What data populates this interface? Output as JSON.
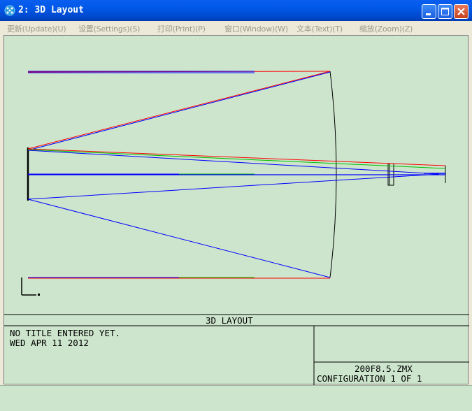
{
  "window": {
    "title": "2: 3D Layout",
    "minimize_label": "minimize",
    "maximize_label": "maximize",
    "close_label": "close"
  },
  "menu": [
    {
      "label": "更新(Update)(U)"
    },
    {
      "label": "设置(Settings)(S)"
    },
    {
      "label": "打印(Print)(P)"
    },
    {
      "label": "窗口(Window)(W)"
    },
    {
      "label": "文本(Text)(T)"
    },
    {
      "label": "缩放(Zoom)(Z)"
    }
  ],
  "plot": {
    "header": "3D LAYOUT",
    "title_line": "NO TITLE ENTERED YET.",
    "date_line": "WED APR 11 2012",
    "filename": "200F8.5.ZMX",
    "configuration": "CONFIGURATION 1 OF 1"
  },
  "colors": {
    "titlebar": "#0058e6",
    "canvas_bg": "#cde5cd",
    "ray_red": "#ff0000",
    "ray_green": "#00c000",
    "ray_blue": "#0000ff",
    "lens": "#000000"
  },
  "icons": {
    "app": "zemax-app-icon",
    "minimize": "minimize-icon",
    "maximize": "maximize-icon",
    "close": "close-icon",
    "axis": "coordinate-axis-icon"
  }
}
